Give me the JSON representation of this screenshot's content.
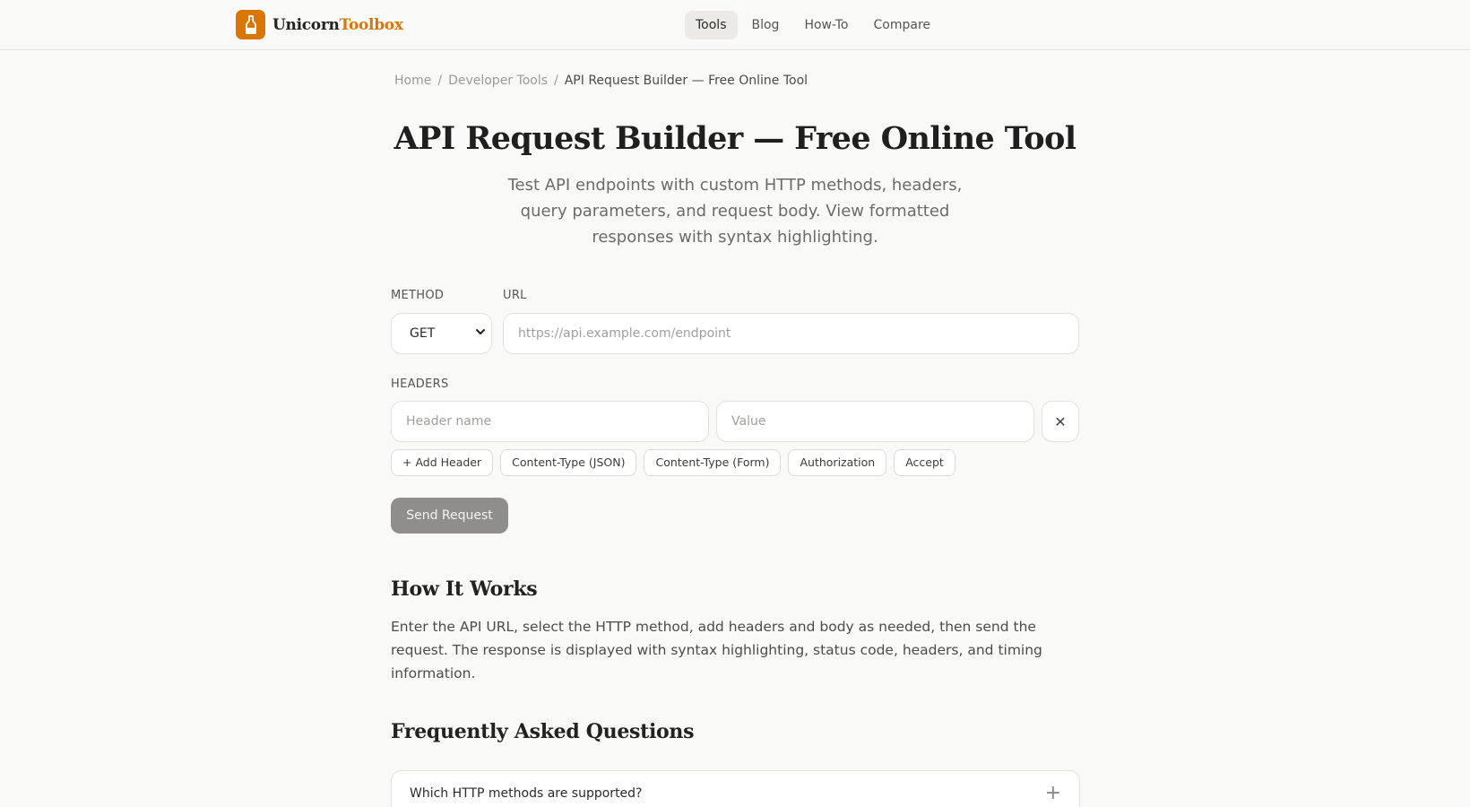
{
  "brand": {
    "name_part1": "Unicorn",
    "name_part2": "Toolbox",
    "color": "#d97706"
  },
  "nav": [
    {
      "label": "Tools",
      "active": true
    },
    {
      "label": "Blog",
      "active": false
    },
    {
      "label": "How-To",
      "active": false
    },
    {
      "label": "Compare",
      "active": false
    }
  ],
  "breadcrumb": {
    "home": "Home",
    "sep": "/",
    "section": "Developer Tools",
    "current": "API Request Builder — Free Online Tool"
  },
  "page": {
    "title": "API Request Builder — Free Online Tool",
    "subtitle": "Test API endpoints with custom HTTP methods, headers, query parameters, and request body. View formatted responses with syntax highlighting."
  },
  "form": {
    "method_label": "METHOD",
    "method_value": "GET",
    "url_label": "URL",
    "url_placeholder": "https://api.example.com/endpoint",
    "headers_label": "HEADERS",
    "header_name_placeholder": "Header name",
    "header_value_placeholder": "Value",
    "remove_glyph": "✕",
    "chips": [
      "+ Add Header",
      "Content-Type (JSON)",
      "Content-Type (Form)",
      "Authorization",
      "Accept"
    ],
    "send_label": "Send Request"
  },
  "how_it_works": {
    "heading": "How It Works",
    "text": "Enter the API URL, select the HTTP method, add headers and body as needed, then send the request. The response is displayed with syntax highlighting, status code, headers, and timing information."
  },
  "faq": {
    "heading": "Frequently Asked Questions",
    "items": [
      {
        "question": "Which HTTP methods are supported?",
        "toggle": "+"
      }
    ]
  },
  "icons": {
    "logo": "bottle-icon",
    "select": "chevron-down-icon",
    "remove": "close-icon",
    "faq_toggle": "plus-icon"
  }
}
